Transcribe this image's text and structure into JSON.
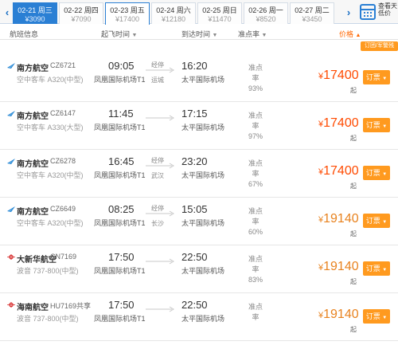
{
  "date_bar": {
    "prev_arrow": "‹",
    "next_arrow": "›",
    "dates": [
      {
        "label": "02-21 周三",
        "price": "¥3090",
        "state": "active"
      },
      {
        "label": "02-22 周四",
        "price": "¥7090",
        "state": ""
      },
      {
        "label": "02-23 周五",
        "price": "¥17400",
        "state": "current"
      },
      {
        "label": "02-24 周六",
        "price": "¥12180",
        "state": ""
      },
      {
        "label": "02-25 周日",
        "price": "¥11470",
        "state": ""
      },
      {
        "label": "02-26 周一",
        "price": "¥8520",
        "state": ""
      },
      {
        "label": "02-27 周二",
        "price": "¥3450",
        "state": ""
      }
    ],
    "calendar_label": "查看天低价"
  },
  "table_header": {
    "flight_info": "航班信息",
    "departure_time": "起飞时间",
    "arrival_time": "到达时间",
    "ontime_rate": "准点率",
    "price": "价格",
    "caret": "▼",
    "price_caret": "▲"
  },
  "group_button": "订团/军警残",
  "flights": [
    {
      "airline": "南方航空",
      "flight_no": "CZ6721",
      "aircraft": "空中客车 A320(中型)",
      "dep_time": "09:05",
      "dep_airport": "凤凰国际机场T1",
      "stop_label": "经停",
      "stop_city": "运城",
      "arr_time": "16:20",
      "arr_airport": "太平国际机场",
      "ontime_label": "准点率",
      "ontime_rate": "93%",
      "price": "17400",
      "price_color": "#ff4a00",
      "logo": "csair"
    },
    {
      "airline": "南方航空",
      "flight_no": "CZ6147",
      "aircraft": "空中客车 A330(大型)",
      "dep_time": "11:45",
      "dep_airport": "凤凰国际机场T1",
      "stop_label": "",
      "stop_city": "",
      "arr_time": "17:15",
      "arr_airport": "太平国际机场",
      "ontime_label": "准点率",
      "ontime_rate": "97%",
      "price": "17400",
      "price_color": "#ff4a00",
      "logo": "csair"
    },
    {
      "airline": "南方航空",
      "flight_no": "CZ6278",
      "aircraft": "空中客车 A320(中型)",
      "dep_time": "16:45",
      "dep_airport": "凤凰国际机场T1",
      "stop_label": "经停",
      "stop_city": "武汉",
      "arr_time": "23:20",
      "arr_airport": "太平国际机场",
      "ontime_label": "准点率",
      "ontime_rate": "67%",
      "price": "17400",
      "price_color": "#ff4a00",
      "logo": "csair"
    },
    {
      "airline": "南方航空",
      "flight_no": "CZ6649",
      "aircraft": "空中客车 A320(中型)",
      "dep_time": "08:25",
      "dep_airport": "凤凰国际机场T1",
      "stop_label": "经停",
      "stop_city": "长沙",
      "arr_time": "15:05",
      "arr_airport": "太平国际机场",
      "ontime_label": "准点率",
      "ontime_rate": "60%",
      "price": "19140",
      "price_color": "#e8821e",
      "logo": "csair"
    },
    {
      "airline": "大新华航空",
      "flight_no": "CN7169",
      "aircraft": "波音 737-800(中型)",
      "dep_time": "17:50",
      "dep_airport": "凤凰国际机场T1",
      "stop_label": "",
      "stop_city": "",
      "arr_time": "22:50",
      "arr_airport": "太平国际机场",
      "ontime_label": "准点率",
      "ontime_rate": "83%",
      "price": "19140",
      "price_color": "#e8821e",
      "logo": "hna"
    },
    {
      "airline": "海南航空",
      "flight_no": "HU7169共享",
      "aircraft": "波音 737-800(中型)",
      "dep_time": "17:50",
      "dep_airport": "凤凰国际机场T1",
      "stop_label": "",
      "stop_city": "",
      "arr_time": "22:50",
      "arr_airport": "太平国际机场",
      "ontime_label": "准点率",
      "ontime_rate": "",
      "price": "19140",
      "price_color": "#e8821e",
      "logo": "hna"
    }
  ],
  "labels": {
    "currency": "¥",
    "price_suffix": "起",
    "book_button": "订票",
    "book_caret": "▼"
  },
  "colors": {
    "accent_blue": "#2a7fd4",
    "price_red": "#ff4a00",
    "price_orange": "#e8821e",
    "button_orange": "#ff9a1f",
    "csair_blue": "#1b7fd0",
    "hna_red": "#d62828"
  }
}
